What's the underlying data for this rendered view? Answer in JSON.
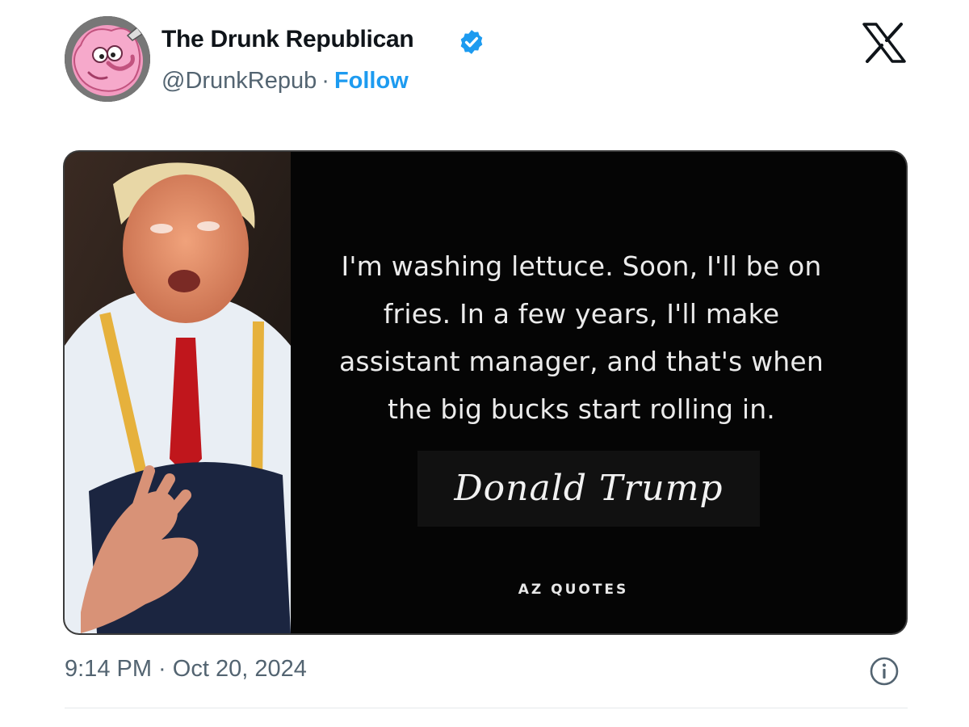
{
  "post": {
    "author": {
      "display_name": "The Drunk Republican",
      "verified": true,
      "handle": "@DrunkRepub",
      "separator": "·",
      "follow_label": "Follow",
      "avatar_icon": "cartoon-pink-elephant-avatar"
    },
    "platform_icon": "x-logo-icon",
    "media": {
      "quote_lines": [
        "I'm washing lettuce. Soon, I'll be on",
        "fries. In a few years, I'll make",
        "assistant manager, and that's when",
        "the big bucks start rolling in."
      ],
      "signature": "Donald Trump",
      "watermark": "AZ QUOTES"
    },
    "timestamp": "9:14 PM · Oct 20, 2024",
    "info_icon": "info-icon"
  },
  "colors": {
    "accent": "#1d9bf0",
    "text_primary": "#0f1419",
    "text_secondary": "#536471",
    "card_background": "#050505",
    "avatar_pink": "#f29ac0"
  }
}
